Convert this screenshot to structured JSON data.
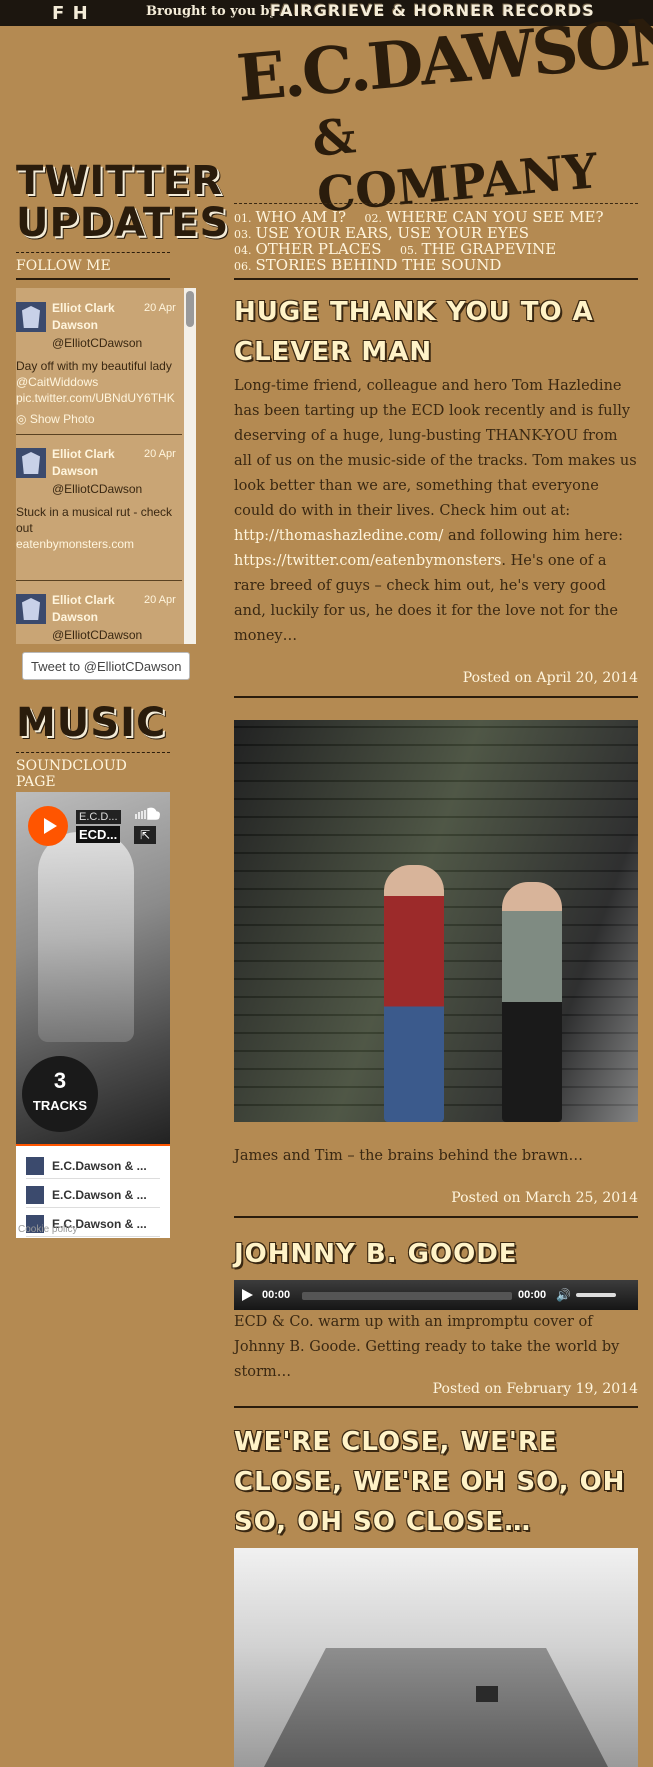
{
  "topbar": {
    "logo_letters": "F H",
    "brought_by": "Brought to you by",
    "label_name": "FAIRGRIEVE & HORNER RECORDS"
  },
  "header": {
    "logo_main": "E.C.DAWSON",
    "logo_sub": "& COMPANY"
  },
  "nav": {
    "items": [
      {
        "num": "01.",
        "label": "WHO AM I?"
      },
      {
        "num": "02.",
        "label": "WHERE CAN YOU SEE ME?"
      },
      {
        "num": "03.",
        "label": "USE YOUR EARS, USE YOUR EYES"
      },
      {
        "num": "04.",
        "label": "OTHER PLACES"
      },
      {
        "num": "05.",
        "label": "THE GRAPEVINE"
      },
      {
        "num": "06.",
        "label": "STORIES BEHIND THE SOUND"
      }
    ]
  },
  "sidebar": {
    "twitter_heading_1": "TWITTER",
    "twitter_heading_2": "UPDATES",
    "follow_me": "FOLLOW ME",
    "tweets": [
      {
        "name": "Elliot Clark Dawson",
        "date": "20 Apr",
        "handle": "@ElliotCDawson",
        "text": "Day off with my beautiful lady ",
        "mention": "@CaitWiddows",
        "link": "pic.twitter.com/UBNdUY6THK",
        "show_photo": "Show Photo"
      },
      {
        "name": "Elliot Clark Dawson",
        "date": "20 Apr",
        "handle": "@ElliotCDawson",
        "text": "Stuck in a musical rut - check out",
        "link": "eatenbymonsters.com"
      },
      {
        "name": "Elliot Clark Dawson",
        "date": "20 Apr",
        "handle": "@ElliotCDawson"
      }
    ],
    "tweet_to": "Tweet to @ElliotCDawson",
    "music_heading": "MUSIC",
    "soundcloud_page": "SOUNDCLOUD PAGE",
    "soundcloud": {
      "artist": "E.C.D...",
      "title": "ECD...",
      "track_count": "3",
      "tracks_label": "TRACKS",
      "tracks": [
        "E.C.Dawson & ...",
        "E.C.Dawson & ...",
        "E.C.Dawson & ..."
      ],
      "cookie_policy": "Cookie policy",
      "accent": "#ff5500"
    }
  },
  "posts": [
    {
      "title": "HUGE THANK YOU TO A CLEVER MAN",
      "body_1": "Long-time friend, colleague and hero Tom Hazledine has been tarting up the ECD look recently and is fully deserving of a huge, lung-busting THANK-YOU from all of us on the music-side of the tracks. Tom makes us look better than we are, something that everyone could do with in their lives. Check him out at: ",
      "link_1": "http://thomashazledine.com/",
      "body_2": " and following him here: ",
      "link_2": "https://twitter.com/eatenbymonsters",
      "body_3": ". He's one of a rare breed of guys – check him out, he's very good and, luckily for us, he does it for the love not for the money…",
      "posted": "Posted on April 20, 2014"
    },
    {
      "caption": "James and Tim – the brains behind the brawn…",
      "posted": "Posted on March 25, 2014"
    },
    {
      "title": "JOHNNY B. GOODE",
      "player_current": "00:00",
      "player_duration": "00:00",
      "body": "ECD & Co. warm up with an impromptu cover of Johnny B. Goode. Getting ready to take the world by storm…",
      "posted": "Posted on February 19, 2014"
    },
    {
      "title": "WE'RE CLOSE, WE'RE CLOSE, WE'RE OH SO, OH SO, OH SO CLOSE…"
    }
  ],
  "colors": {
    "background": "#b48a52",
    "dark": "#2a1c0c",
    "light_text": "#fff5dd"
  }
}
